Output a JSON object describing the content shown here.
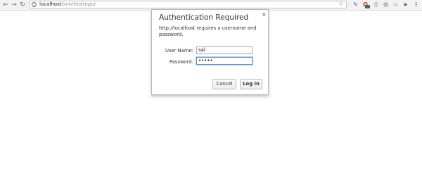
{
  "toolbar": {
    "back_icon": "back-arrow-icon",
    "forward_icon": "forward-arrow-icon",
    "reload_icon": "reload-icon",
    "url_host": "localhost",
    "url_path": "/svn/testrepo/",
    "extensions": [
      "pencil-icon",
      "opera-icon",
      "printer-icon",
      "circle-icon",
      "arrows-icon",
      "rocket-icon",
      "menu-icon"
    ]
  },
  "dialog": {
    "title": "Authentication Required",
    "close_glyph": "×",
    "message": "http://localhost requires a username and password.",
    "username_label": "User Name:",
    "username_value": "sai",
    "password_label": "Password:",
    "password_value": "•••••",
    "cancel_label": "Cancel",
    "login_label": "Log In"
  },
  "colors": {
    "focus_border": "#5b8fd6",
    "opera_red": "#d5262a"
  }
}
